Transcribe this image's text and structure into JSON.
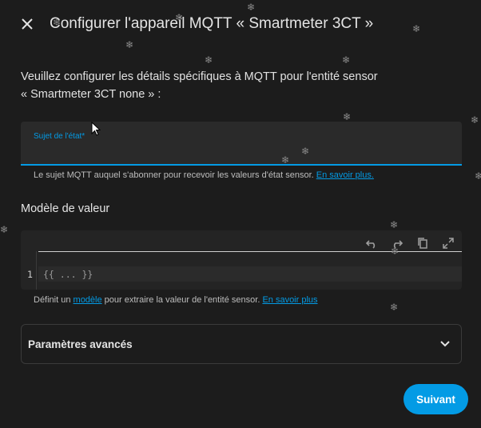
{
  "dialog": {
    "title": "Configurer l'appareil MQTT « Smartmeter 3CT »",
    "close_icon": "close-icon"
  },
  "description": {
    "line1": "Veuillez configurer les détails spécifiques à MQTT pour l'entité sensor",
    "line2": "« Smartmeter 3CT none » :"
  },
  "state_topic": {
    "label": "Sujet de l'état*",
    "value": "",
    "helper_text": "Le sujet MQTT auquel s'abonner pour recevoir les valeurs d'état sensor. ",
    "helper_link": "En savoir plus."
  },
  "value_template": {
    "section_title": "Modèle de valeur",
    "toolbar_icons": [
      "undo-icon",
      "redo-icon",
      "copy-icon",
      "fullscreen-icon"
    ],
    "line_number": "1",
    "code": "{{ ... }}",
    "helper_prefix": "Définit un ",
    "helper_link1": "modèle",
    "helper_middle": " pour extraire la valeur de l'entité sensor. ",
    "helper_link2": "En savoir plus"
  },
  "advanced": {
    "label": "Paramètres avancés",
    "icon": "chevron-down-icon"
  },
  "actions": {
    "next_label": "Suivant"
  },
  "colors": {
    "accent": "#039be5",
    "background": "#1c1c1c",
    "field_background": "#2a2a2a"
  }
}
